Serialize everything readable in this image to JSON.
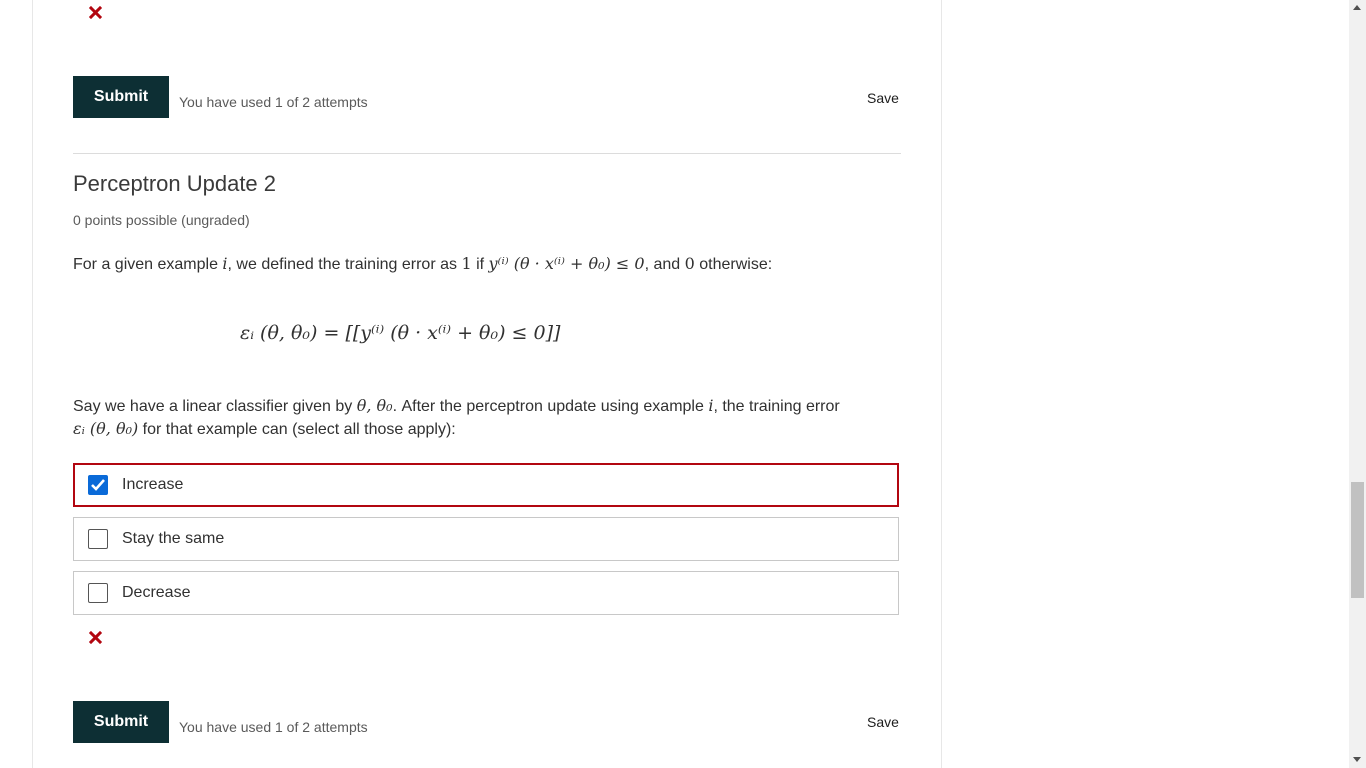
{
  "prev_problem": {
    "submit_label": "Submit",
    "attempts_text": "You have used 1 of 2 attempts",
    "save_label": "Save",
    "status_icon": "incorrect-x-icon"
  },
  "problem": {
    "title": "Perceptron Update 2",
    "points": "0 points possible (ungraded)",
    "para1": {
      "t1": "For a given example ",
      "m_i": "i",
      "t2": ", we defined the training error as ",
      "m_one": "1",
      "t3": " if ",
      "m_expr": "y⁽ⁱ⁾ (θ · x⁽ⁱ⁾ + θ₀) ≤ 0",
      "t4": ", and ",
      "m_zero": "0",
      "t5": " otherwise:"
    },
    "formula": "εᵢ (θ, θ₀) = [[y⁽ⁱ⁾ (θ · x⁽ⁱ⁾ + θ₀) ≤ 0]]",
    "para2": {
      "t1": "Say we have a linear classifier given by ",
      "m_theta": "θ, θ₀",
      "t2": ". After the perceptron update using example ",
      "m_i": "i",
      "t3": ", the training error ",
      "m_eps": "εᵢ (θ, θ₀)",
      "t4": " for that example can (select all those apply):"
    },
    "choices": [
      {
        "label": "Increase",
        "checked": true
      },
      {
        "label": "Stay the same",
        "checked": false
      },
      {
        "label": "Decrease",
        "checked": false
      }
    ],
    "status_icon": "incorrect-x-icon",
    "submit_label": "Submit",
    "attempts_text": "You have used 1 of 2 attempts",
    "save_label": "Save"
  },
  "colors": {
    "submit_bg": "#0d2f34",
    "incorrect": "#b20610",
    "checkbox_checked": "#0a6ad8"
  }
}
